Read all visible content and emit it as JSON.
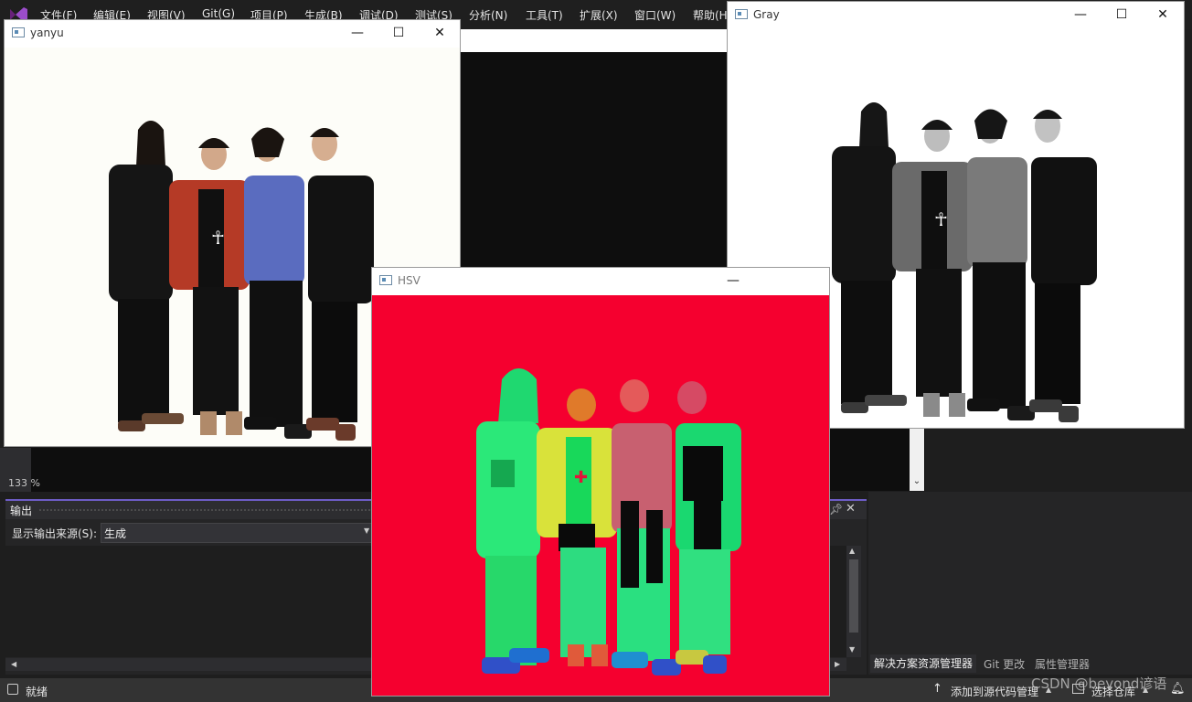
{
  "menu": [
    "文件(F)",
    "编辑(E)",
    "视图(V)",
    "Git(G)",
    "项目(P)",
    "生成(B)",
    "调试(D)",
    "测试(S)",
    "分析(N)",
    "工具(T)",
    "扩展(X)",
    "窗口(W)",
    "帮助(H)"
  ],
  "editor": {
    "zoom": "133 %"
  },
  "output": {
    "title": "输出",
    "source_label": "显示输出来源(S):",
    "source_value": "生成"
  },
  "dock_tabs": [
    "解决方案资源管理器",
    "Git 更改",
    "属性管理器"
  ],
  "status": {
    "ready": "就绪",
    "add_source_control": "添加到源代码管理",
    "select_repo": "选择仓库"
  },
  "watermark": "CSDN @beyond谚语",
  "windows": {
    "yanyu": {
      "title": "yanyu",
      "image": "color-band-photo"
    },
    "gray": {
      "title": "Gray",
      "image": "grayscale-band-photo"
    },
    "hsv": {
      "title": "HSV",
      "image": "hsv-band-photo"
    }
  },
  "colors": {
    "accent": "#6e5dc6",
    "hsv_background": "#f5002f",
    "hsv_figure_green": "#22e27a",
    "hsv_figure_yellow": "#e0e63a"
  },
  "icons": [
    "vs-logo-icon",
    "window-icon",
    "minimize-icon",
    "maximize-icon",
    "close-icon",
    "pin-icon",
    "chevron-down-icon",
    "arrow-up-icon",
    "repo-icon",
    "bell-icon"
  ]
}
